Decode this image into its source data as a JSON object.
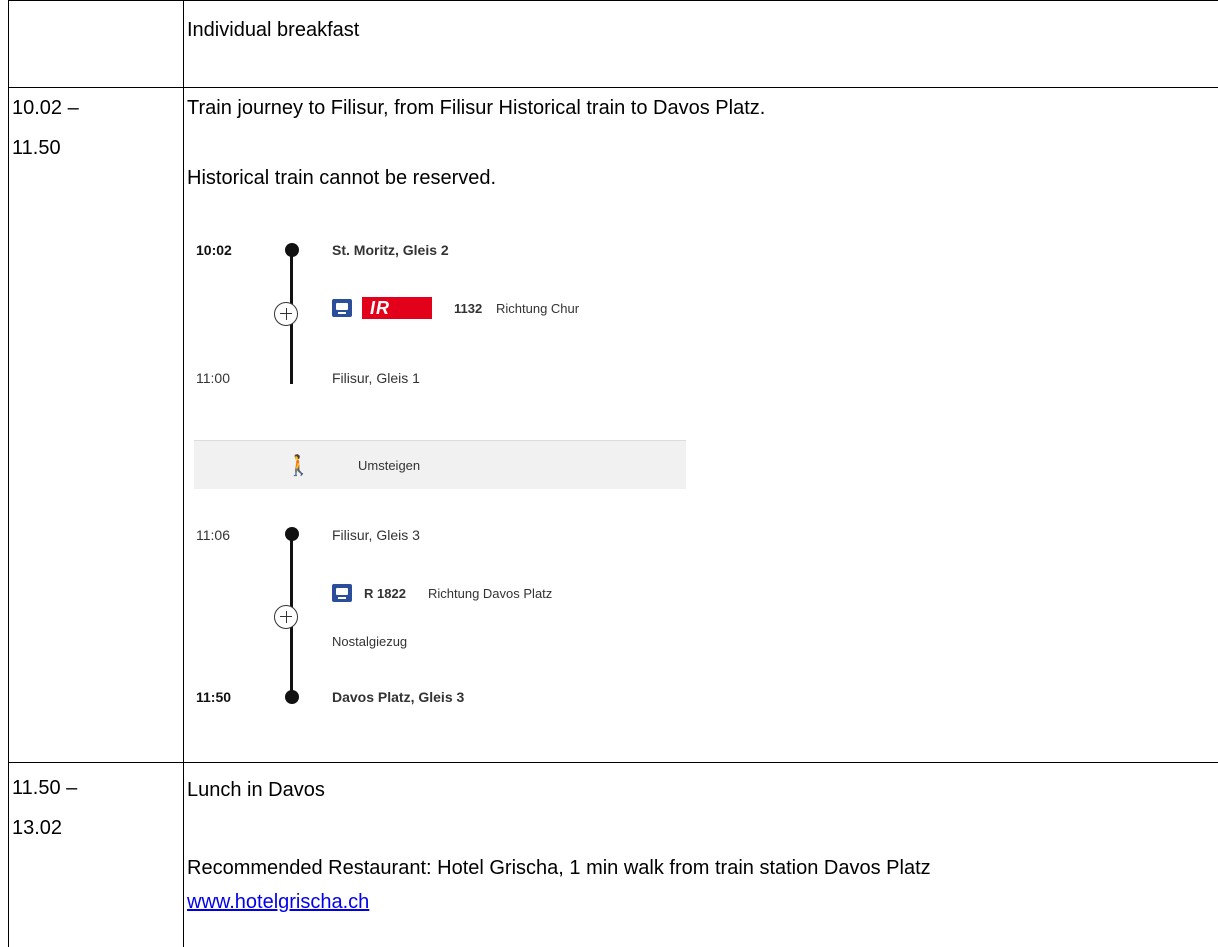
{
  "rows": [
    {
      "time_start": "",
      "time_end": "",
      "lines": [
        "Individual breakfast"
      ]
    },
    {
      "time_start": "10.02 –",
      "time_end": "11.50",
      "lines": [
        "Train journey to Filisur, from Filisur Historical train to Davos Platz.",
        "Historical train cannot be reserved."
      ]
    },
    {
      "time_start": "11.50 –",
      "time_end": "13.02",
      "lines": [
        "Lunch in Davos",
        "Recommended Restaurant: Hotel Grischa, 1 min walk from train station Davos Platz"
      ],
      "link": "www.hotelgrischa.ch"
    }
  ],
  "timetable": {
    "leg1": {
      "dep_time": "10:02",
      "dep_stop": "St. Moritz, Gleis 2",
      "train_badge": "IR",
      "train_number": "1132",
      "direction": "Richtung Chur",
      "arr_time": "11:00",
      "arr_stop": "Filisur, Gleis 1"
    },
    "transfer_label": "Umsteigen",
    "leg2": {
      "dep_time": "11:06",
      "dep_stop": "Filisur, Gleis 3",
      "train_number": "R 1822",
      "direction": "Richtung Davos Platz",
      "note": "Nostalgiezug",
      "arr_time": "11:50",
      "arr_stop": "Davos Platz, Gleis 3"
    },
    "colors": {
      "line": "#111111",
      "ir_red": "#e3001b",
      "train_icon_blue": "#2b4e9b",
      "walk_bar": "#f1f1f1"
    },
    "icons": [
      "train-icon",
      "walk-icon",
      "expand-plus-icon"
    ]
  }
}
